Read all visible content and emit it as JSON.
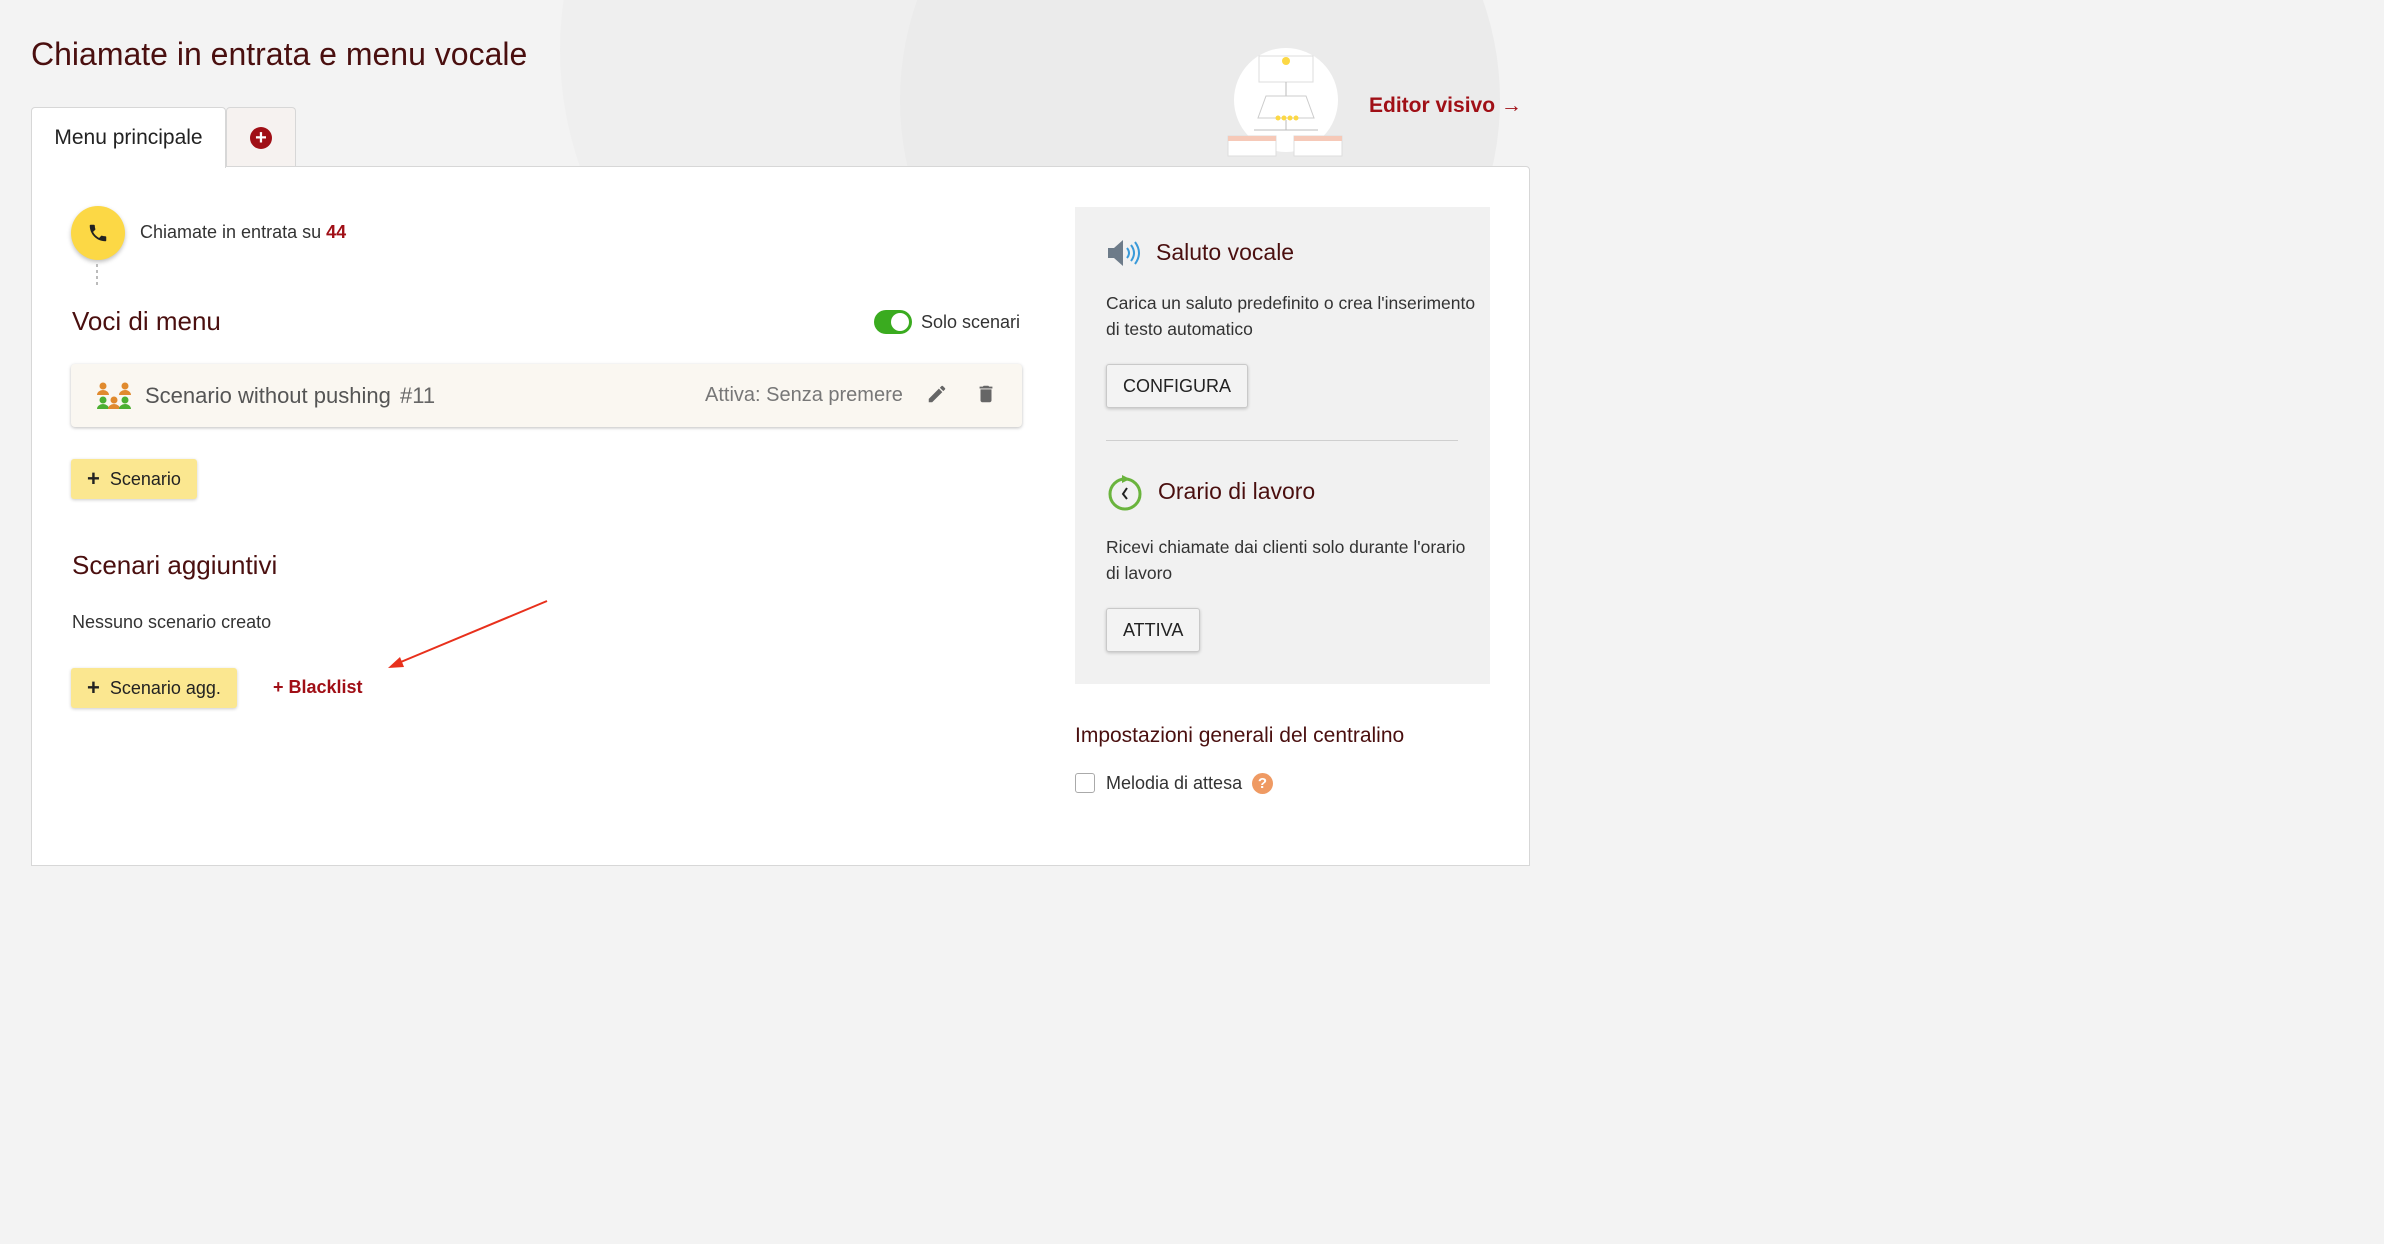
{
  "page": {
    "title": "Chiamate in entrata e menu vocale"
  },
  "tabs": [
    {
      "label": "Menu principale",
      "active": true
    },
    {
      "label": "+",
      "icon": "add-circle-icon"
    }
  ],
  "editor": {
    "label": "Editor visivo →"
  },
  "incoming": {
    "text": "Chiamate in entrata su",
    "number": "44"
  },
  "menu": {
    "title": "Voci di menu",
    "toggle": {
      "label": "Solo scenari",
      "on": true
    },
    "scenario": {
      "name": "Scenario without pushing",
      "number": "#11",
      "status": "Attiva: Senza premere"
    },
    "add_label": "Scenario"
  },
  "additional": {
    "title": "Scenari aggiuntivi",
    "empty_text": "Nessuno scenario creato",
    "add_label": "Scenario agg.",
    "blacklist_label": "+ Blacklist"
  },
  "side": {
    "greeting": {
      "title": "Saluto vocale",
      "text": "Carica un saluto predefinito o crea l'inserimento di testo automatico",
      "button": "CONFIGURA"
    },
    "hours": {
      "title": "Orario di lavoro",
      "text": "Ricevi chiamate dai clienti solo durante l'orario di lavoro",
      "button": "ATTIVA"
    }
  },
  "general": {
    "title": "Impostazioni generali del centralino",
    "melody_label": "Melodia di attesa",
    "melody_checked": false
  },
  "colors": {
    "accent": "#a00f16",
    "title": "#4a0f0f",
    "button_yellow": "#fbe790",
    "toggle_green": "#3aab1f"
  }
}
